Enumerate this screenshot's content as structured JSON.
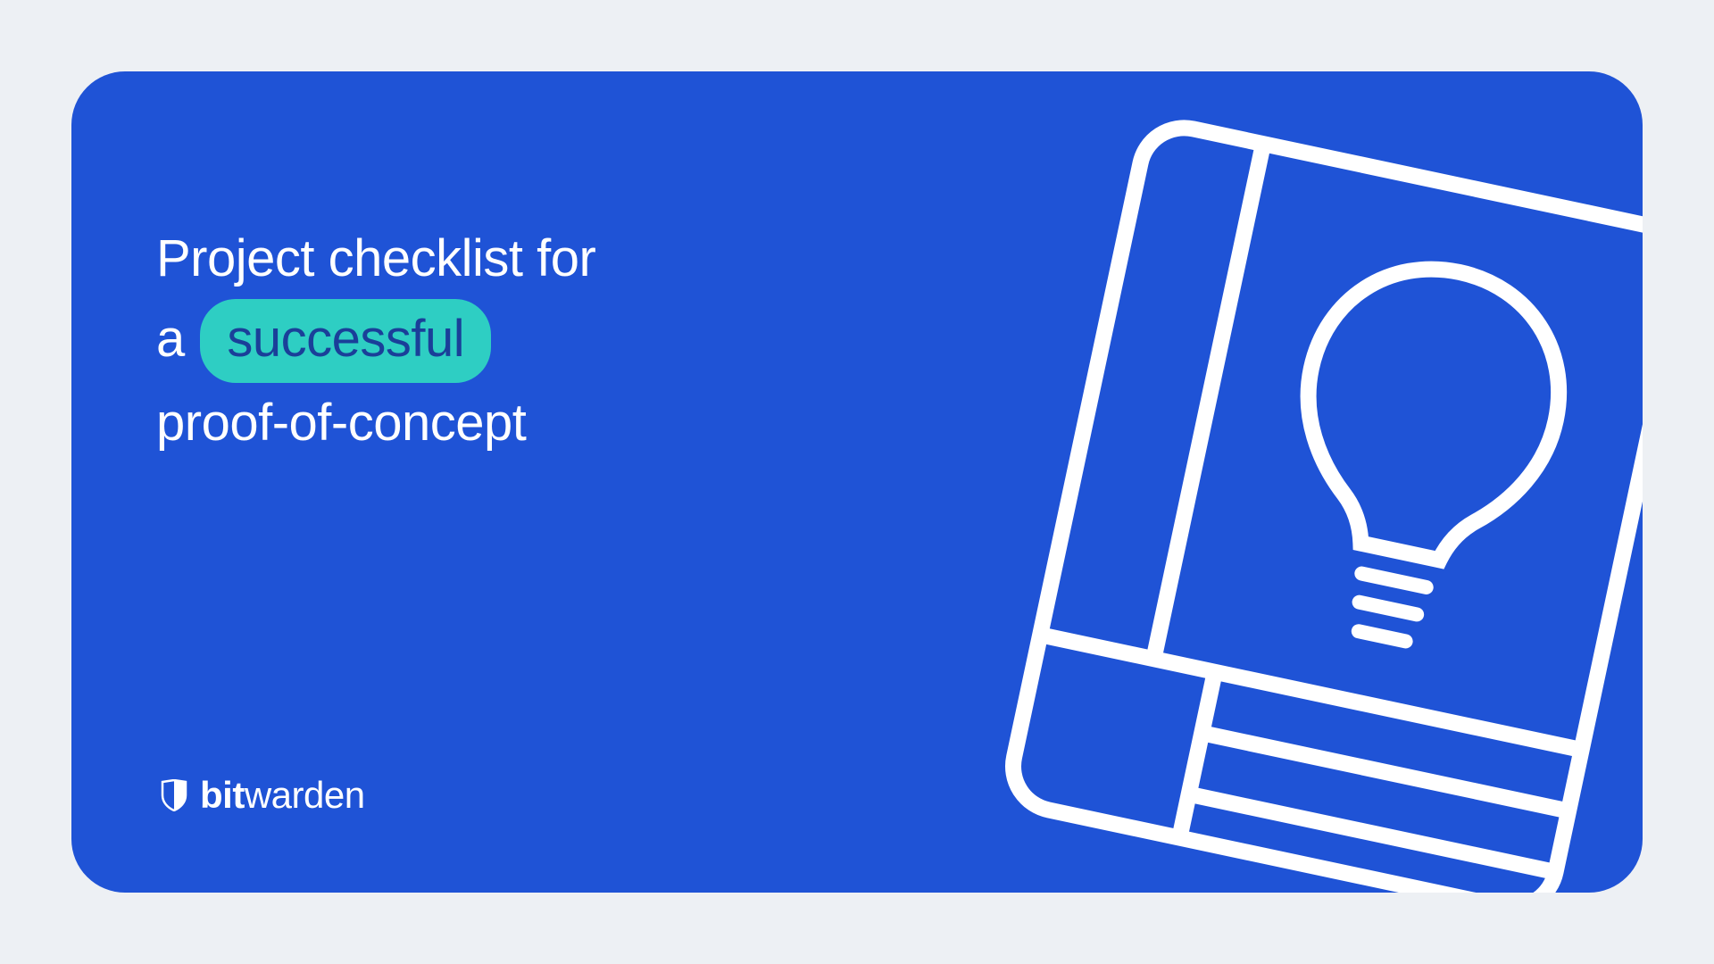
{
  "heading": {
    "line1": "Project checklist for",
    "line2_prefix": "a",
    "line2_highlight": "successful",
    "line3": "proof-of-concept"
  },
  "brand": {
    "name_bold": "bit",
    "name_rest": "warden"
  },
  "colors": {
    "background": "#edf0f4",
    "card": "#1f53d6",
    "highlight": "#2ecec3",
    "text": "#ffffff",
    "highlightText": "#1a3f99"
  }
}
